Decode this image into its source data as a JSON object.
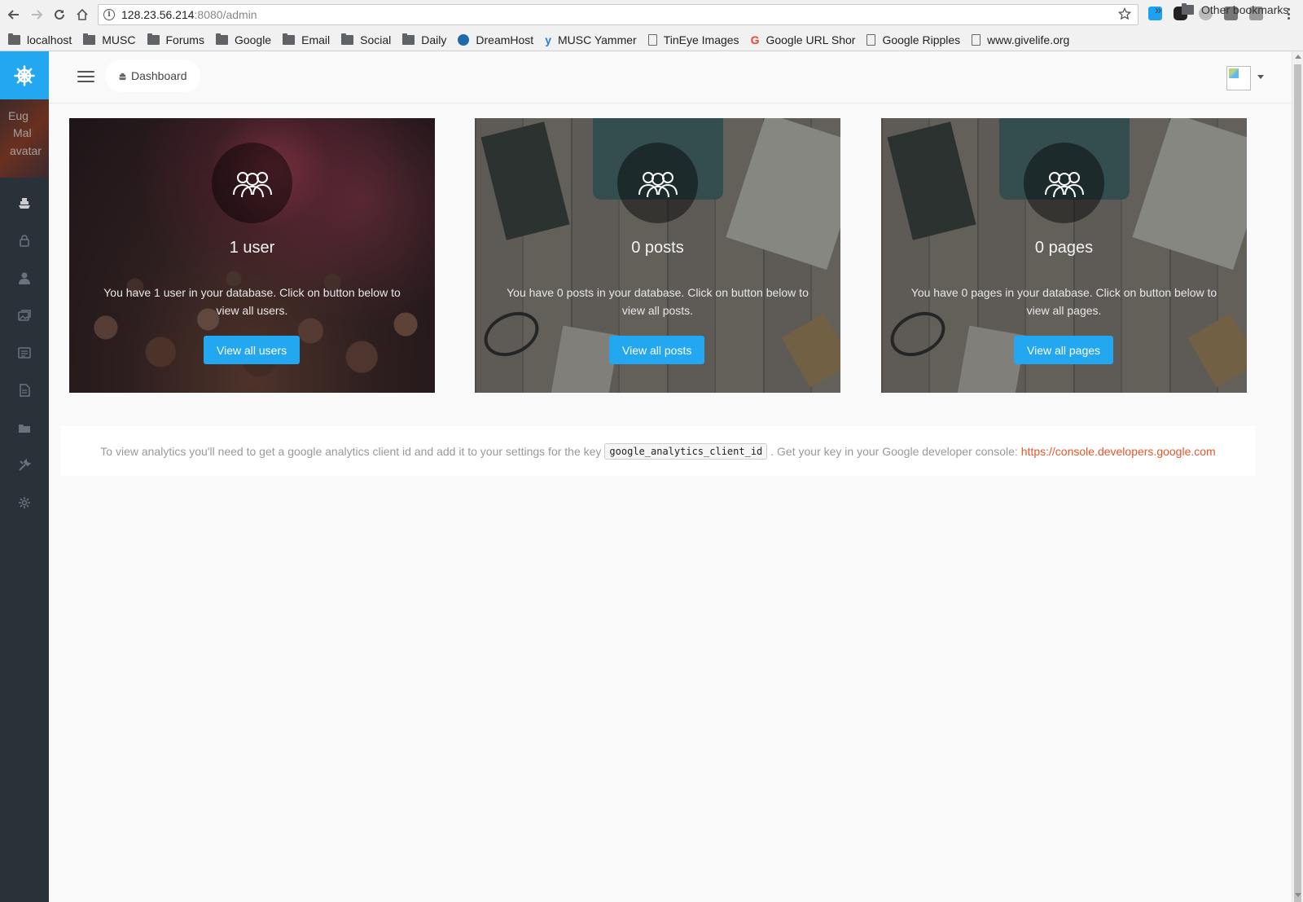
{
  "browser": {
    "url_host": "128.23.56.214",
    "url_path": ":8080/admin",
    "bookmarks": [
      {
        "label": "localhost",
        "icon": "folder-icon"
      },
      {
        "label": "MUSC",
        "icon": "folder-icon"
      },
      {
        "label": "Forums",
        "icon": "folder-icon"
      },
      {
        "label": "Google",
        "icon": "folder-icon"
      },
      {
        "label": "Email",
        "icon": "folder-icon"
      },
      {
        "label": "Social",
        "icon": "folder-icon"
      },
      {
        "label": "Daily",
        "icon": "folder-icon"
      },
      {
        "label": "DreamHost",
        "icon": "dreamhost-icon"
      },
      {
        "label": "MUSC Yammer",
        "icon": "yammer-icon"
      },
      {
        "label": "TinEye Images",
        "icon": "page-icon"
      },
      {
        "label": "Google URL Shor",
        "icon": "google-icon"
      },
      {
        "label": "Google Ripples",
        "icon": "page-icon"
      },
      {
        "label": "www.givelife.org",
        "icon": "page-icon"
      }
    ],
    "more_label": "»",
    "other_bookmarks": "Other bookmarks"
  },
  "sidebar": {
    "avatar_alt_lines": [
      "Eug",
      "Mal",
      "avatar"
    ],
    "items": [
      {
        "name": "dashboard",
        "icon": "boat-icon"
      },
      {
        "name": "roles",
        "icon": "lock-icon"
      },
      {
        "name": "users",
        "icon": "user-icon"
      },
      {
        "name": "media",
        "icon": "images-icon"
      },
      {
        "name": "posts",
        "icon": "news-icon"
      },
      {
        "name": "pages",
        "icon": "file-icon"
      },
      {
        "name": "categories",
        "icon": "folder-icon"
      },
      {
        "name": "tools",
        "icon": "tools-icon"
      },
      {
        "name": "settings",
        "icon": "gear-icon"
      }
    ]
  },
  "topbar": {
    "breadcrumb": "Dashboard"
  },
  "cards": [
    {
      "count": "1 user",
      "description": "You have 1 user in your database. Click on button below to view all users.",
      "button": "View all users"
    },
    {
      "count": "0 posts",
      "description": "You have 0 posts in your database. Click on button below to view all posts.",
      "button": "View all posts"
    },
    {
      "count": "0 pages",
      "description": "You have 0 pages in your database. Click on button below to view all pages.",
      "button": "View all pages"
    }
  ],
  "analytics": {
    "text_before": "To view analytics you'll need to get a google analytics client id and add it to your settings for the key",
    "key": "google_analytics_client_id",
    "text_after": ". Get your key in your Google developer console:",
    "link": "https://console.developers.google.com"
  },
  "colors": {
    "accent": "#22a7f0",
    "sidebar": "#2a3138",
    "link": "#e8562a"
  }
}
